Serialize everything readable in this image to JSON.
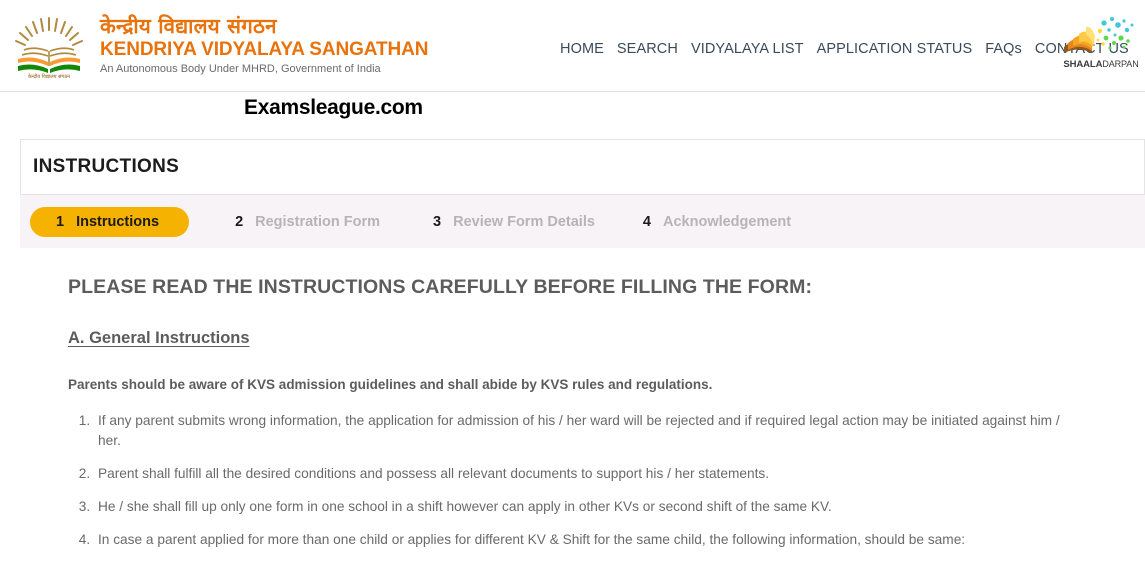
{
  "header": {
    "logo": {
      "name": "kvs-emblem",
      "hindi_title": "केन्द्रीय विद्यालय संगठन",
      "english_title": "KENDRIYA VIDYALAYA SANGATHAN",
      "subtitle": "An Autonomous Body Under MHRD, Government of India"
    },
    "nav": [
      {
        "label": "HOME"
      },
      {
        "label": "SEARCH"
      },
      {
        "label": "VIDYALAYA LIST"
      },
      {
        "label": "APPLICATION STATUS"
      },
      {
        "label": "FAQs"
      },
      {
        "label": "CONTACT US"
      }
    ],
    "darpan": {
      "bold_part": "SHAALA",
      "thin_part": "DARPAN"
    }
  },
  "watermark": {
    "text": "Examsleague.com"
  },
  "card": {
    "title": "INSTRUCTIONS"
  },
  "stepper": {
    "active_color": "#f5b200",
    "inactive_color": "#b7b3b7",
    "steps": [
      {
        "number": "1",
        "label": "Instructions",
        "active": true
      },
      {
        "number": "2",
        "label": "Registration Form",
        "active": false
      },
      {
        "number": "3",
        "label": "Review Form Details",
        "active": false
      },
      {
        "number": "4",
        "label": "Acknowledgement",
        "active": false
      }
    ]
  },
  "content": {
    "heading": "PLEASE READ THE INSTRUCTIONS CAREFULLY BEFORE FILLING THE FORM:",
    "section_heading": "A. General Instructions",
    "lead_note": "Parents should be aware of KVS admission guidelines and shall abide by KVS rules and regulations.",
    "rules": [
      "If any parent submits wrong information, the application for admission of his / her ward will be rejected and if required legal action may be initiated against him / her.",
      "Parent shall fulfill all the desired conditions and possess all relevant documents to support his / her statements.",
      "He / she shall fill up only one form in one school in a shift however can apply in other KVs or second shift of the same KV.",
      "In case a parent applied for more than one child or applies for different KV & Shift for the same child, the following information, should be same:"
    ]
  }
}
